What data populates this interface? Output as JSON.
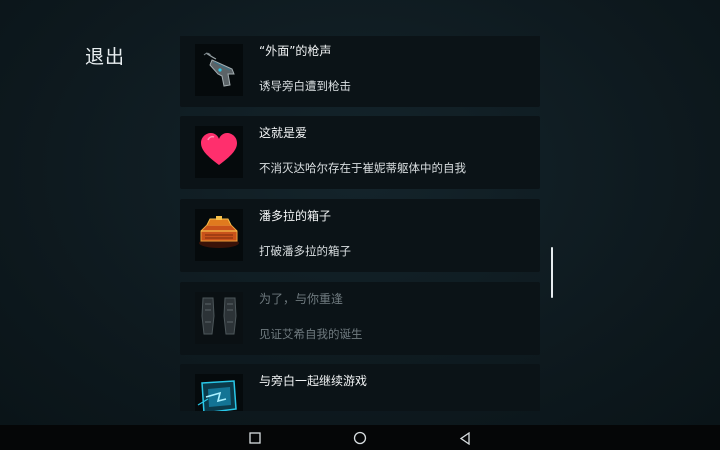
{
  "header": {
    "exit_label": "退出"
  },
  "achievements": [
    {
      "title": "“外面”的枪声",
      "description": "诱导旁白遭到枪击",
      "icon": "pistol-icon",
      "locked": false
    },
    {
      "title": "这就是爱",
      "description": "不消灭达哈尔存在于崔妮蒂躯体中的自我",
      "icon": "heart-icon",
      "locked": false
    },
    {
      "title": "潘多拉的箱子",
      "description": "打破潘多拉的箱子",
      "icon": "pandora-box-icon",
      "locked": false
    },
    {
      "title": "为了，与你重逢",
      "description": "见证艾希自我的诞生",
      "icon": "figures-icon",
      "locked": true
    },
    {
      "title": "与旁白一起继续游戏",
      "description": "",
      "icon": "screen-icon",
      "locked": false
    }
  ],
  "colors": {
    "background": "#0f1a1f",
    "card": "#0b1317",
    "heart": "#ff2f6d",
    "accent_cyan": "#29c8e8",
    "box_orange": "#e07a1e"
  },
  "navbar": {
    "icons": [
      "square-icon",
      "circle-icon",
      "back-triangle-icon"
    ]
  }
}
